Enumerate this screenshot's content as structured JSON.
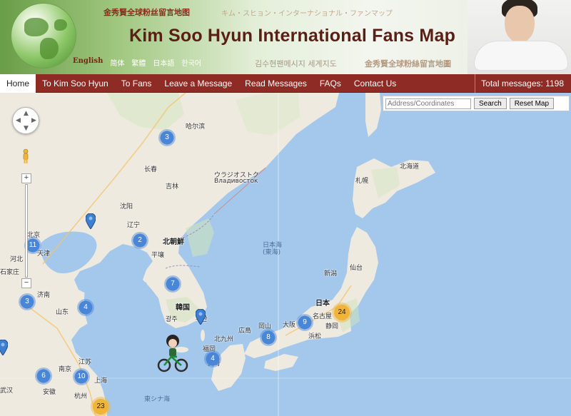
{
  "header": {
    "title": "Kim Soo Hyun International Fans Map",
    "subtitle_cn": "金秀賢全球粉丝留言地图",
    "subtitle_jp": "キム・スヒョン・インターナショナル・ファンマップ",
    "subtitle_kr": "김수현팬메시지 세계지도",
    "subtitle_cn_traditional": "金秀賢全球粉絲留言地圖",
    "languages": [
      "English",
      "简体",
      "繁體",
      "日本語",
      "한국어"
    ]
  },
  "nav": {
    "items": [
      "Home",
      "To Kim Soo Hyun",
      "To Fans",
      "Leave a Message",
      "Read Messages",
      "FAQs",
      "Contact Us"
    ],
    "total_label": "Total messages: 1198"
  },
  "search": {
    "placeholder": "Address/Coordinates",
    "search_label": "Search",
    "reset_label": "Reset Map"
  },
  "map": {
    "controls": {
      "zoom_in": "+",
      "zoom_out": "−"
    },
    "clusters": [
      {
        "count": "3",
        "color": "blue"
      },
      {
        "count": "2",
        "color": "blue"
      },
      {
        "count": "11",
        "color": "blue"
      },
      {
        "count": "3",
        "color": "blue"
      },
      {
        "count": "4",
        "color": "blue"
      },
      {
        "count": "7",
        "color": "blue"
      },
      {
        "count": "9",
        "color": "blue"
      },
      {
        "count": "8",
        "color": "blue"
      },
      {
        "count": "4",
        "color": "blue"
      },
      {
        "count": "6",
        "color": "blue"
      },
      {
        "count": "10",
        "color": "blue"
      },
      {
        "count": "24",
        "color": "yellow"
      },
      {
        "count": "23",
        "color": "yellow"
      }
    ],
    "labels": {
      "harbin": "哈尔滨",
      "changchun": "长春",
      "jilin": "吉林",
      "vladivostok_jp": "ウラジオストク",
      "vladivostok_ru": "Владивосток",
      "shenyang": "沈阳",
      "liaoning": "辽宁",
      "north_korea": "北朝鮮",
      "pyongyang": "平壤",
      "beijing": "北京",
      "tianjin": "天津",
      "hebei": "河北",
      "shijiazhuang": "石家庄",
      "jinan": "济南",
      "shandong": "山东",
      "south_korea": "韓国",
      "gwangju": "광주",
      "busan": "부산",
      "sea_of_japan": "日本海",
      "east_sea": "(東海)",
      "sapporo": "札幌",
      "hokkaido": "北海道",
      "sendai": "仙台",
      "niigata": "新潟",
      "japan": "日本",
      "nagoya": "名古屋",
      "osaka": "大阪",
      "hiroshima": "広島",
      "okayama": "岡山",
      "kitakyushu": "北九州",
      "fukuoka": "福岡",
      "shizuoka": "静岡",
      "hamamatsu": "浜松",
      "nagasaki": "長崎",
      "jiangsu": "江苏",
      "nanjing": "南京",
      "shanghai": "上海",
      "anhui": "安徽",
      "hangzhou": "杭州",
      "wuhan": "武汉",
      "east_china_sea": "東シナ海"
    }
  },
  "colors": {
    "nav_bg": "#8e2b24",
    "title": "#5a1e14",
    "sea": "#a3c8ec",
    "land": "#efeae0",
    "cluster_blue": "#4a86d8",
    "cluster_yellow": "#f0b43a"
  }
}
